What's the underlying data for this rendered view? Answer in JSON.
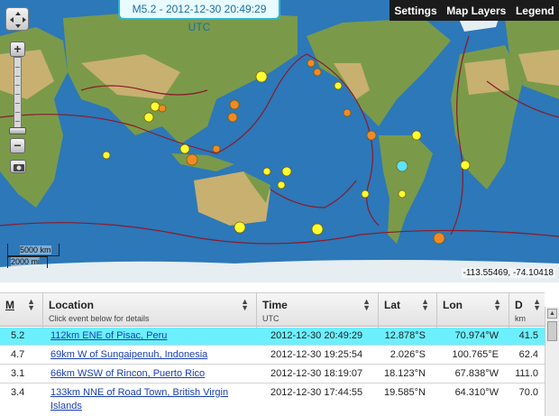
{
  "map": {
    "title": "M5.2 - 2012-12-30 20:49:29 UTC",
    "toolbar": [
      "Settings",
      "Map Layers",
      "Legend"
    ],
    "zoom_in": "+",
    "zoom_out": "−",
    "scale_km": "5000 km",
    "scale_mi": "2000 mi",
    "coordinates": "-113.55469, -74.10418",
    "colors": {
      "ocean": "#2c78b8",
      "land": "#7a9a4a",
      "desert": "#c8b070",
      "ice": "#e6eef2",
      "plate_boundary": "#8b1a2a",
      "quake_yellow": "#ffff30",
      "quake_orange": "#f08a24",
      "quake_selected": "#5be3ff"
    }
  },
  "table": {
    "columns": [
      {
        "label": "M",
        "sub": ""
      },
      {
        "label": "Location",
        "sub": "Click event below for details"
      },
      {
        "label": "Time",
        "sub": "UTC"
      },
      {
        "label": "Lat",
        "sub": ""
      },
      {
        "label": "Lon",
        "sub": ""
      },
      {
        "label": "D",
        "sub": "km"
      }
    ],
    "rows": [
      {
        "mag": "5.2",
        "location": "112km ENE of Pisac, Peru",
        "location2": "",
        "time": "2012-12-30 20:49:29",
        "lat": "12.878°S",
        "lon": "70.974°W",
        "depth": "41.5"
      },
      {
        "mag": "4.7",
        "location": "69km W of Sungaipenuh, Indonesia",
        "location2": "",
        "time": "2012-12-30 19:25:54",
        "lat": "2.026°S",
        "lon": "100.765°E",
        "depth": "62.4"
      },
      {
        "mag": "3.1",
        "location": "66km WSW of Rincon, Puerto Rico",
        "location2": "",
        "time": "2012-12-30 18:19:07",
        "lat": "18.123°N",
        "lon": "67.838°W",
        "depth": "111.0"
      },
      {
        "mag": "3.4",
        "location": "133km NNE of Road Town, British Virgin",
        "location2": "Islands",
        "time": "2012-12-30 17:44:55",
        "lat": "19.585°N",
        "lon": "64.310°W",
        "depth": "70.0"
      }
    ]
  }
}
